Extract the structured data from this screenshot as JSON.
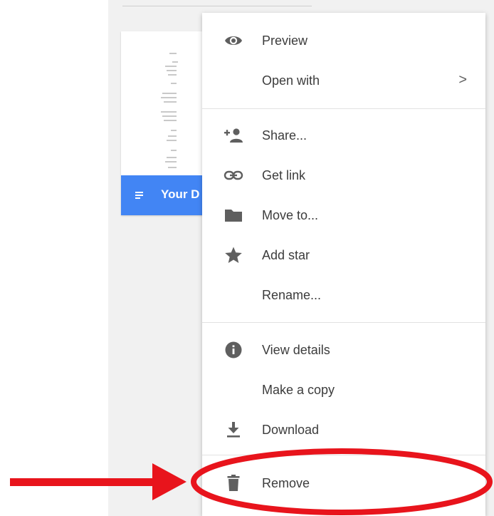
{
  "file_card": {
    "title": "Your D",
    "accent_color": "#4285f4",
    "icon": "doc-icon"
  },
  "context_menu": {
    "items": [
      {
        "label": "Preview",
        "icon": "eye-icon"
      },
      {
        "label": "Open with",
        "icon": "",
        "submenu_indicator": ">"
      },
      {
        "label": "Share...",
        "icon": "add-person-icon"
      },
      {
        "label": "Get link",
        "icon": "link-icon"
      },
      {
        "label": "Move to...",
        "icon": "folder-icon"
      },
      {
        "label": "Add star",
        "icon": "star-icon"
      },
      {
        "label": "Rename...",
        "icon": ""
      },
      {
        "label": "View details",
        "icon": "info-icon"
      },
      {
        "label": "Make a copy",
        "icon": ""
      },
      {
        "label": "Download",
        "icon": "download-icon"
      },
      {
        "label": "Remove",
        "icon": "trash-icon"
      }
    ]
  },
  "annotation": {
    "arrow_color": "#e8141c",
    "ellipse_color": "#e8141c",
    "highlighted_item": "Remove"
  }
}
